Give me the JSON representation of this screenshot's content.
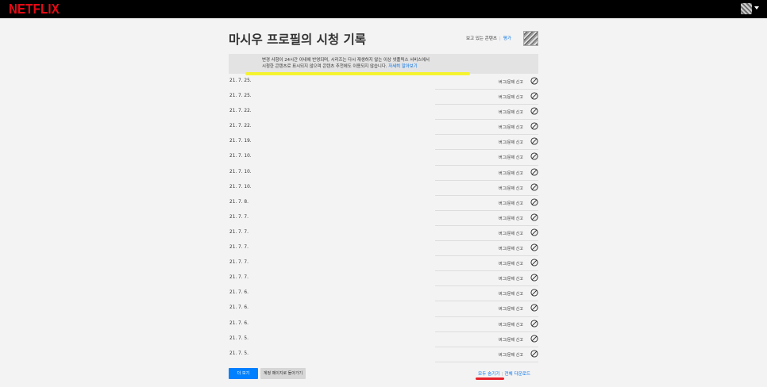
{
  "app": {
    "logo": "NETFLIX"
  },
  "header": {
    "title": "마시우 프로필의 시청 기록",
    "view_label": "보고 있는 콘텐츠",
    "rating_label": "평가"
  },
  "notice": {
    "line1": "변경 사항이 24시간 이내에 반영되며,           시리즈는 다시 재생하지 않는 이상 넷플릭스 서비스에서",
    "line2": "시청한 콘텐츠로 표시되지 않으며 콘텐츠 추천에도 이용되지 않습니다.",
    "learn_more": "자세히 알아보기"
  },
  "rows": [
    {
      "date": "21. 7. 25.",
      "report": "버그/문제 신고"
    },
    {
      "date": "21. 7. 25.",
      "report": "버그/문제 신고"
    },
    {
      "date": "21. 7. 22.",
      "report": "버그/문제 신고"
    },
    {
      "date": "21. 7. 22.",
      "report": "버그/문제 신고"
    },
    {
      "date": "21. 7. 19.",
      "report": "버그/문제 신고"
    },
    {
      "date": "21. 7. 10.",
      "report": "버그/문제 신고"
    },
    {
      "date": "21. 7. 10.",
      "report": "버그/문제 신고"
    },
    {
      "date": "21. 7. 10.",
      "report": "버그/문제 신고"
    },
    {
      "date": "21. 7. 8.",
      "report": "버그/문제 신고"
    },
    {
      "date": "21. 7. 7.",
      "report": "버그/문제 신고"
    },
    {
      "date": "21. 7. 7.",
      "report": "버그/문제 신고"
    },
    {
      "date": "21. 7. 7.",
      "report": "버그/문제 신고"
    },
    {
      "date": "21. 7. 7.",
      "report": "버그/문제 신고"
    },
    {
      "date": "21. 7. 7.",
      "report": "버그/문제 신고"
    },
    {
      "date": "21. 7. 6.",
      "report": "버그/문제 신고"
    },
    {
      "date": "21. 7. 6.",
      "report": "버그/문제 신고"
    },
    {
      "date": "21. 7. 6.",
      "report": "버그/문제 신고"
    },
    {
      "date": "21. 7. 5.",
      "report": "버그/문제 신고"
    },
    {
      "date": "21. 7. 5.",
      "report": "버그/문제 신고"
    }
  ],
  "footer": {
    "more_label": "더 보기",
    "back_label": "계정 페이지로 돌아가기",
    "hide_all_label": "모두 숨기기",
    "download_all_label": "전체 다운로드"
  },
  "colors": {
    "brand": "#e50914",
    "accent": "#0071eb",
    "highlight": "#f6f41a",
    "annotation": "#e8202a"
  },
  "icons": {
    "row_action": "hide-from-history-icon",
    "account_menu": "chevron-down-icon"
  }
}
